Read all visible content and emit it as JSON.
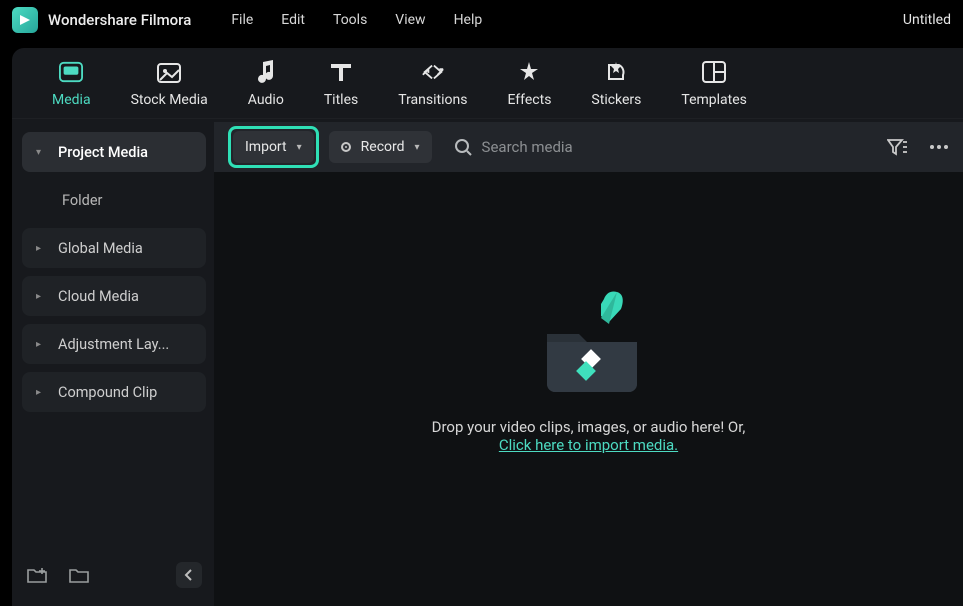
{
  "app": {
    "name": "Wondershare Filmora",
    "documentTitle": "Untitled"
  },
  "menu": [
    "File",
    "Edit",
    "Tools",
    "View",
    "Help"
  ],
  "tabs": [
    {
      "label": "Media",
      "icon": "media-icon",
      "active": true
    },
    {
      "label": "Stock Media",
      "icon": "stock-media-icon"
    },
    {
      "label": "Audio",
      "icon": "audio-icon"
    },
    {
      "label": "Titles",
      "icon": "titles-icon"
    },
    {
      "label": "Transitions",
      "icon": "transitions-icon"
    },
    {
      "label": "Effects",
      "icon": "effects-icon"
    },
    {
      "label": "Stickers",
      "icon": "stickers-icon"
    },
    {
      "label": "Templates",
      "icon": "templates-icon"
    }
  ],
  "sidebar": {
    "items": [
      {
        "label": "Project Media",
        "selected": true,
        "type": "down"
      },
      {
        "label": "Folder",
        "type": "plain"
      },
      {
        "label": "Global Media",
        "type": "expand"
      },
      {
        "label": "Cloud Media",
        "type": "expand"
      },
      {
        "label": "Adjustment Lay...",
        "type": "expand"
      },
      {
        "label": "Compound Clip",
        "type": "expand"
      }
    ]
  },
  "toolbar": {
    "import_label": "Import",
    "record_label": "Record",
    "search_placeholder": "Search media"
  },
  "drop": {
    "text": "Drop your video clips, images, or audio here! Or,",
    "link": "Click here to import media."
  }
}
